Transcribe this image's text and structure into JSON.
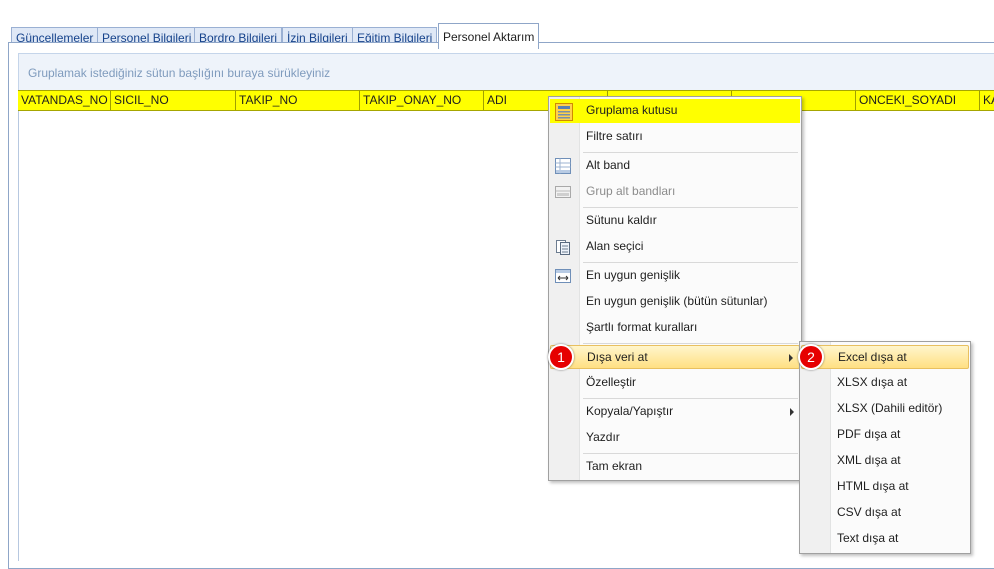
{
  "tabs": [
    {
      "label": "Güncellemeler"
    },
    {
      "label": "Personel Bilgileri"
    },
    {
      "label": "Bordro Bilgileri"
    },
    {
      "label": "İzin Bilgileri"
    },
    {
      "label": "Eğitim Bilgileri"
    },
    {
      "label": "Personel Aktarım"
    }
  ],
  "grid": {
    "group_panel_text": "Gruplamak istediğiniz sütun başlığını buraya sürükleyiniz",
    "columns": [
      "VATANDAS_NO",
      "SICIL_NO",
      "TAKIP_NO",
      "TAKIP_ONAY_NO",
      "ADI",
      "",
      "",
      "ONCEKI_SOYADI",
      "KA"
    ]
  },
  "context_menu": {
    "items": [
      {
        "label": "Gruplama kutusu",
        "icon": "group-box-icon"
      },
      {
        "label": "Filtre satırı"
      },
      {
        "label": "Alt band",
        "icon": "footer-band-icon"
      },
      {
        "label": "Grup alt bandları",
        "icon": "group-footer-icon",
        "disabled": true
      },
      {
        "label": "Sütunu kaldır"
      },
      {
        "label": "Alan seçici",
        "icon": "column-chooser-icon"
      },
      {
        "label": "En uygun genişlik",
        "icon": "best-fit-icon"
      },
      {
        "label": "En uygun genişlik (bütün sütunlar)"
      },
      {
        "label": "Şartlı format kuralları"
      },
      {
        "label": "Dışa veri at",
        "submenu": true
      },
      {
        "label": "Özelleştir"
      },
      {
        "label": "Kopyala/Yapıştır",
        "submenu": true
      },
      {
        "label": "Yazdır"
      },
      {
        "label": "Tam ekran"
      }
    ]
  },
  "export_submenu": {
    "items": [
      {
        "label": "Excel dışa at"
      },
      {
        "label": "XLSX dışa at"
      },
      {
        "label": "XLSX (Dahili editör)"
      },
      {
        "label": "PDF dışa at"
      },
      {
        "label": "XML dışa at"
      },
      {
        "label": "HTML dışa at"
      },
      {
        "label": "CSV dışa at"
      },
      {
        "label": "Text dışa at"
      }
    ]
  },
  "badges": [
    "1",
    "2"
  ],
  "colors": {
    "header_highlight": "#ffff00",
    "menu_hover": "#ffe083",
    "badge": "#e60000",
    "tab_text": "#15428b"
  }
}
